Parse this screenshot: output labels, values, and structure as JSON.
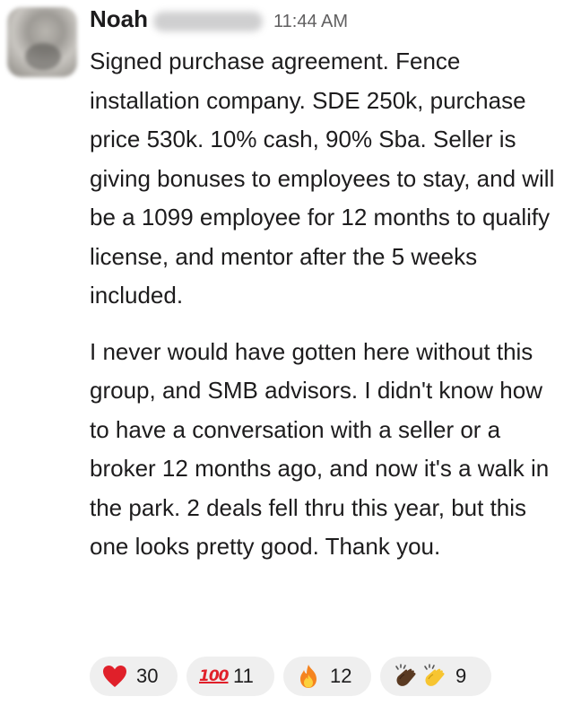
{
  "message": {
    "author": {
      "name": "Noah",
      "surname_redacted": true
    },
    "timestamp": "11:44 AM",
    "paragraphs": [
      "Signed purchase agreement. Fence installation company. SDE 250k, purchase price 530k. 10% cash, 90% Sba. Seller is giving bonuses to employees to stay, and will be a 1099 employee for 12 months to qualify license, and mentor after the 5 weeks included.",
      "I never would have gotten here without this group, and SMB advisors. I didn't know how to have a conversation with a seller or a broker 12 months ago, and now it's a walk in the park. 2 deals fell thru this year, but this one looks pretty good. Thank you."
    ],
    "reactions": [
      {
        "icon": "heart-emoji",
        "count": "30"
      },
      {
        "icon": "hundred-points-emoji",
        "label": "100",
        "count": "11"
      },
      {
        "icon": "fire-emoji",
        "count": "12"
      },
      {
        "icon": "clapping-hands-emoji",
        "count": "9"
      }
    ]
  },
  "colors": {
    "text": "#1d1c1d",
    "muted": "#616061",
    "reaction_bg": "#efefef",
    "heart": "#e0202a",
    "fire_outer": "#f5841f",
    "fire_inner": "#fcd13c"
  }
}
